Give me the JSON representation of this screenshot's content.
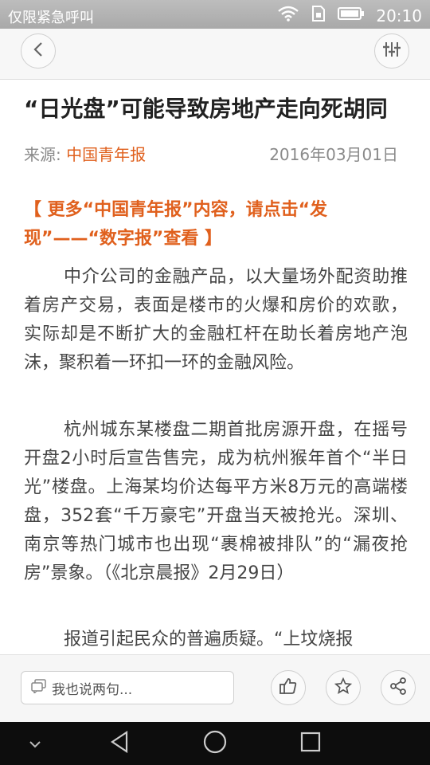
{
  "status_bar": {
    "carrier": "仅限紧急呼叫",
    "time": "20:10",
    "icons": [
      "wifi-icon",
      "sim-icon",
      "battery-icon"
    ]
  },
  "app_bar": {
    "back_icon": "back-chevron-icon",
    "settings_icon": "sliders-icon"
  },
  "article": {
    "title": "“日光盘”可能导致房地产走向死胡同",
    "source_label": "来源:",
    "source_name": "中国青年报",
    "date": "2016年03月01日",
    "promo": "【 更多“中国青年报”内容，请点击“发现”——“数字报”查看 】",
    "paragraphs": [
      "中介公司的金融产品，以大量场外配资助推着房产交易，表面是楼市的火爆和房价的欢歌，实际却是不断扩大的金融杠杆在助长着房地产泡沫，聚积着一环扣一环的金融风险。",
      "杭州城东某楼盘二期首批房源开盘，在摇号开盘2小时后宣告售完，成为杭州猴年首个“半日光”楼盘。上海某均价达每平方米8万元的高端楼盘，352套“千万豪宅”开盘当天被抢光。深圳、南京等热门城市也出现“裹棉被排队”的“漏夜抢房”景象。（《北京晨报》2月29日）",
      "报道引起民众的普遍质疑。“上坟烧报"
    ]
  },
  "bottom_bar": {
    "comment_placeholder": "我也说两句...",
    "actions": [
      "like-icon",
      "star-icon",
      "share-icon"
    ]
  },
  "nav_bar": {
    "buttons": [
      "chevron-down-icon",
      "back-triangle-icon",
      "home-circle-icon",
      "recents-square-icon"
    ]
  },
  "colors": {
    "accent": "#e0601d",
    "body_text": "#444444",
    "status_bar": "#b3b3b3"
  }
}
